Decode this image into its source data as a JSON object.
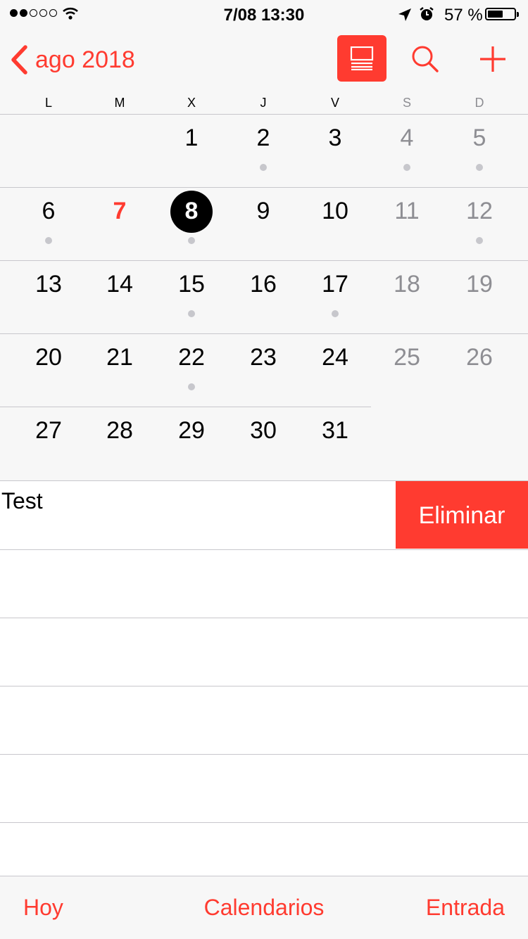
{
  "status_bar": {
    "time": "7/08 13:30",
    "battery_percent_text": "57 %",
    "battery_level": 0.57,
    "signal_bars_filled": 2,
    "signal_bars_total": 5
  },
  "nav": {
    "back_label": "ago 2018",
    "icons": [
      "chevron-left-icon",
      "list-view-icon",
      "search-icon",
      "plus-icon"
    ]
  },
  "weekdays": [
    "L",
    "M",
    "X",
    "J",
    "V",
    "S",
    "D"
  ],
  "month": {
    "first_weekday_index": 2,
    "days_in_month": 31,
    "today": 7,
    "selected": 8,
    "event_days": [
      2,
      4,
      5,
      6,
      8,
      12,
      15,
      17,
      22
    ]
  },
  "events": [
    {
      "title": "Test",
      "swipe_action": "Eliminar"
    }
  ],
  "tab_bar": {
    "today": "Hoy",
    "calendars": "Calendarios",
    "inbox": "Entrada"
  },
  "colors": {
    "accent": "#ff3b30",
    "weekend_text": "#8e8e93",
    "event_dot": "#c7c7cc",
    "selected_circle": "#000000"
  }
}
